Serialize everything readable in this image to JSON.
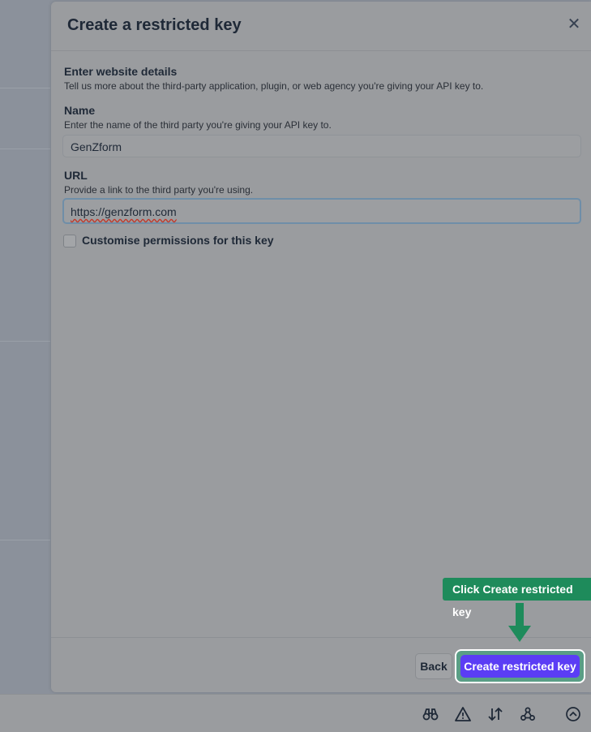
{
  "modal": {
    "title": "Create a restricted key",
    "close_icon": "close-icon",
    "section": {
      "title": "Enter website details",
      "description": "Tell us more about the third-party application, plugin, or web agency you're giving your API key to."
    },
    "name_field": {
      "label": "Name",
      "help": "Enter the name of the third party you're giving your API key to.",
      "value": "GenZform"
    },
    "url_field": {
      "label": "URL",
      "help": "Provide a link to the third party you're using.",
      "value": "https://genzform.com"
    },
    "customise_checkbox": {
      "label": "Customise permissions for this key",
      "checked": false
    },
    "footer": {
      "back_label": "Back",
      "create_label": "Create restricted key"
    }
  },
  "tooltip": {
    "text": "Click Create restricted key"
  },
  "bottom_bar": {
    "icons": [
      "binoculars-icon",
      "warning-icon",
      "sort-arrows-icon",
      "webhook-icon",
      "chevron-up-circle-icon"
    ]
  },
  "colors": {
    "primary_button": "#5b3df5",
    "tooltip": "#1e8b5b",
    "text": "#1f2937"
  }
}
